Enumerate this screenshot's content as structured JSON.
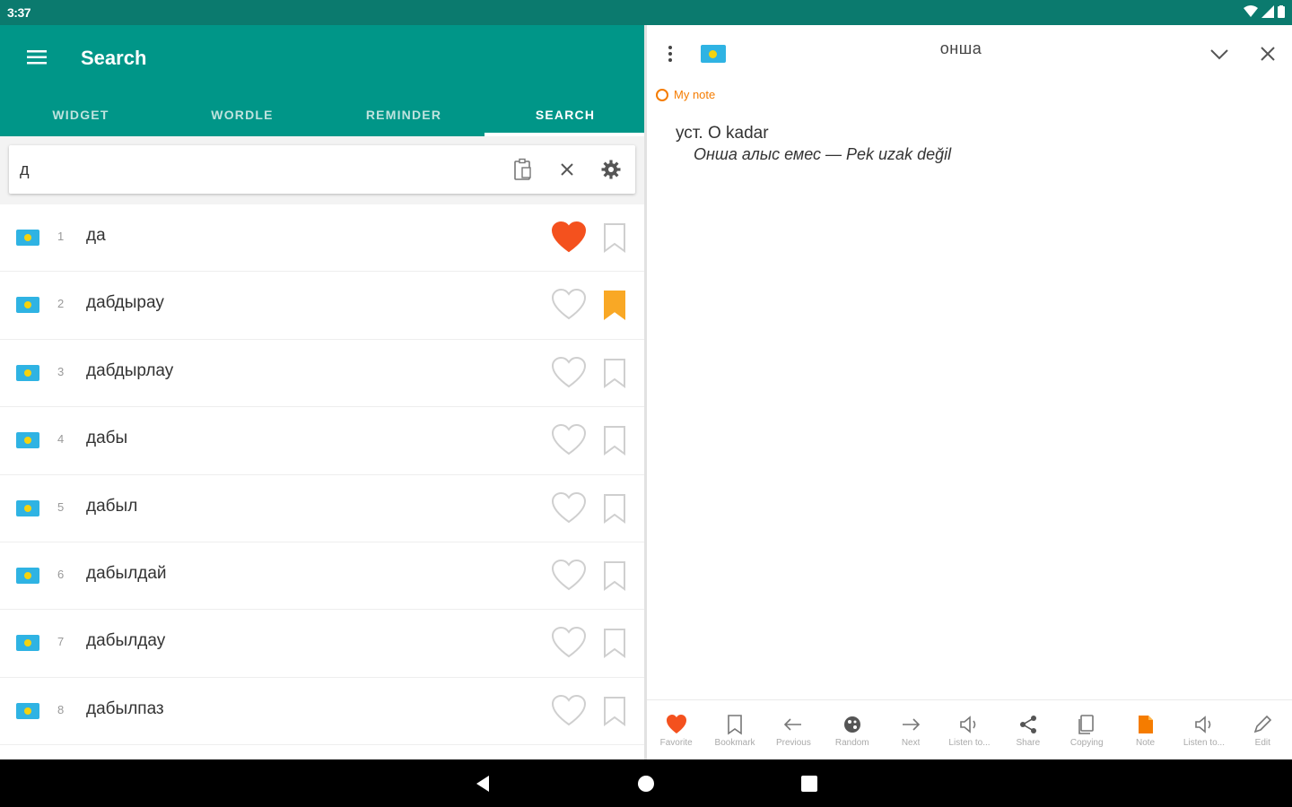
{
  "status_bar": {
    "time": "3:37"
  },
  "left_panel": {
    "title": "Search",
    "tabs": [
      {
        "label": "WIDGET",
        "active": false
      },
      {
        "label": "WORDLE",
        "active": false
      },
      {
        "label": "REMINDER",
        "active": false
      },
      {
        "label": "SEARCH",
        "active": true
      }
    ],
    "search": {
      "value": "д"
    },
    "results": [
      {
        "index": "1",
        "word": "да",
        "favorite": true,
        "bookmark": false
      },
      {
        "index": "2",
        "word": "дабдырау",
        "favorite": false,
        "bookmark": true
      },
      {
        "index": "3",
        "word": "дабдырлау",
        "favorite": false,
        "bookmark": false
      },
      {
        "index": "4",
        "word": "дабы",
        "favorite": false,
        "bookmark": false
      },
      {
        "index": "5",
        "word": "дабыл",
        "favorite": false,
        "bookmark": false
      },
      {
        "index": "6",
        "word": "дабылдай",
        "favorite": false,
        "bookmark": false
      },
      {
        "index": "7",
        "word": "дабылдау",
        "favorite": false,
        "bookmark": false
      },
      {
        "index": "8",
        "word": "дабылпаз",
        "favorite": false,
        "bookmark": false
      }
    ]
  },
  "right_panel": {
    "word": "онша",
    "note_label": "My note",
    "definition": "уст. O kadar",
    "example": "Онша алыс емес — Pek uzak değil",
    "toolbar": [
      {
        "label": "Favorite",
        "icon": "heart-icon"
      },
      {
        "label": "Bookmark",
        "icon": "bookmark-icon"
      },
      {
        "label": "Previous",
        "icon": "arrow-left-icon"
      },
      {
        "label": "Random",
        "icon": "random-icon"
      },
      {
        "label": "Next",
        "icon": "arrow-right-icon"
      },
      {
        "label": "Listen to...",
        "icon": "speaker-icon"
      },
      {
        "label": "Share",
        "icon": "share-icon"
      },
      {
        "label": "Copying",
        "icon": "copy-icon"
      },
      {
        "label": "Note",
        "icon": "note-icon"
      },
      {
        "label": "Listen to...",
        "icon": "speaker-icon"
      },
      {
        "label": "Edit",
        "icon": "pencil-icon"
      }
    ]
  },
  "colors": {
    "primary": "#009688",
    "status_bar": "#0b7a6e",
    "favorite": "#f4511e",
    "bookmark": "#f9a825",
    "note": "#f57c00"
  }
}
